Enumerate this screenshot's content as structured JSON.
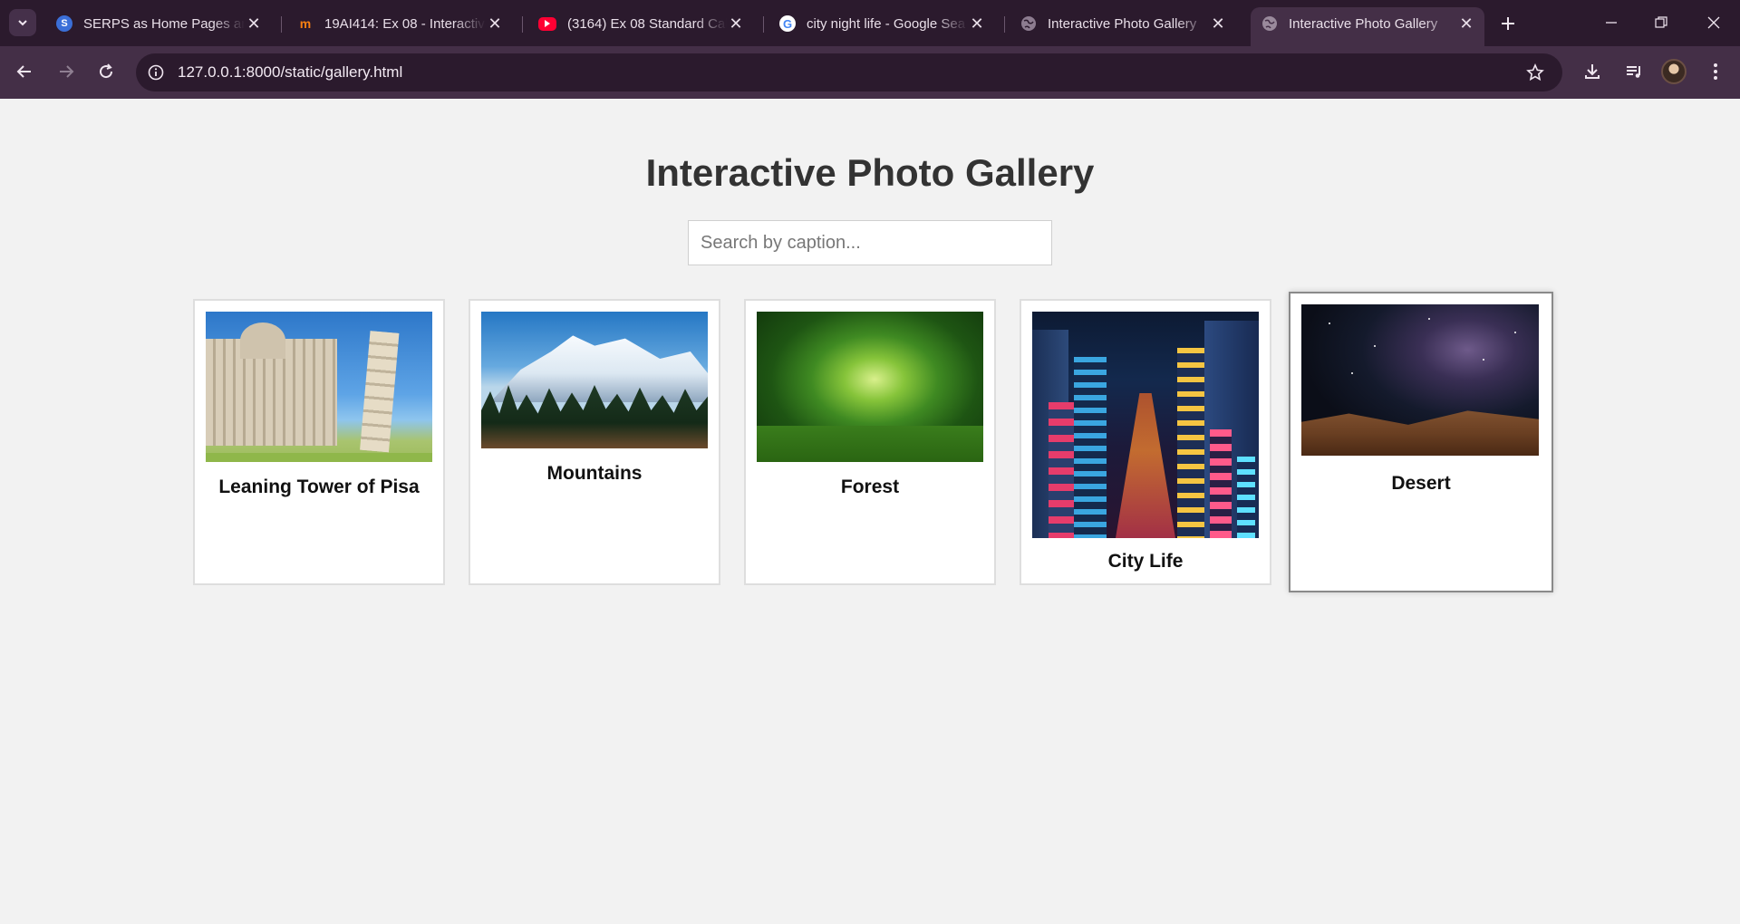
{
  "browser": {
    "tabs": [
      {
        "title": "SERPS as Home Pages and",
        "icon": "serps-favicon-icon",
        "color": "#3b6fd8"
      },
      {
        "title": "19AI414: Ex 08 - Interactive",
        "icon": "moodle-favicon-icon",
        "color": "#f98012"
      },
      {
        "title": "(3164) Ex 08 Standard Calc",
        "icon": "youtube-favicon-icon",
        "color": "#ff0033"
      },
      {
        "title": "city night life - Google Sea",
        "icon": "google-favicon-icon",
        "color": "#4285f4"
      },
      {
        "title": "Interactive Photo Gallery",
        "icon": "globe-icon",
        "color": "#9a8a9c"
      },
      {
        "title": "Interactive Photo Gallery",
        "icon": "globe-icon",
        "color": "#9a8a9c"
      }
    ],
    "active_tab_index": 5,
    "url": "127.0.0.1:8000/static/gallery.html"
  },
  "page": {
    "title": "Interactive Photo Gallery",
    "search_placeholder": "Search by caption..."
  },
  "gallery": [
    {
      "caption": "Leaning Tower of Pisa",
      "image": "pisa"
    },
    {
      "caption": "Mountains",
      "image": "mountains"
    },
    {
      "caption": "Forest",
      "image": "forest"
    },
    {
      "caption": "City Life",
      "image": "city"
    },
    {
      "caption": "Desert",
      "image": "desert"
    }
  ]
}
